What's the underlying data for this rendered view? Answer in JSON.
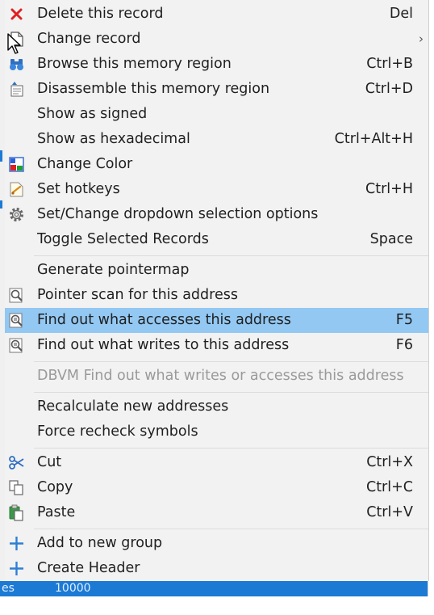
{
  "menu": {
    "items": [
      {
        "id": "delete",
        "label": "Delete this record",
        "shortcut": "Del",
        "icon": "delete-x-icon"
      },
      {
        "id": "change",
        "label": "Change record",
        "shortcut": "",
        "icon": "document-icon",
        "submenu": true
      },
      {
        "id": "browse",
        "label": "Browse this memory region",
        "shortcut": "Ctrl+B",
        "icon": "binoculars-icon"
      },
      {
        "id": "disassemble",
        "label": "Disassemble this memory region",
        "shortcut": "Ctrl+D",
        "icon": "disassemble-icon"
      },
      {
        "id": "signed",
        "label": "Show as signed",
        "shortcut": ""
      },
      {
        "id": "hex",
        "label": "Show as hexadecimal",
        "shortcut": "Ctrl+Alt+H"
      },
      {
        "id": "color",
        "label": "Change Color",
        "shortcut": "",
        "icon": "color-palette-icon"
      },
      {
        "id": "hotkeys",
        "label": "Set hotkeys",
        "shortcut": "Ctrl+H",
        "icon": "hotkey-icon"
      },
      {
        "id": "dropdown",
        "label": "Set/Change dropdown selection options",
        "shortcut": "",
        "icon": "gear-icon"
      },
      {
        "id": "toggle",
        "label": "Toggle Selected Records",
        "shortcut": "Space"
      },
      {
        "id": "pointermap",
        "label": "Generate pointermap",
        "shortcut": ""
      },
      {
        "id": "pointerscan",
        "label": "Pointer scan for this address",
        "shortcut": "",
        "icon": "magnifier-icon"
      },
      {
        "id": "accesses",
        "label": "Find out what accesses this address",
        "shortcut": "F5",
        "icon": "magnifier-list-icon",
        "highlighted": true
      },
      {
        "id": "writes",
        "label": "Find out what writes to this address",
        "shortcut": "F6",
        "icon": "magnifier-list-icon"
      },
      {
        "id": "dbvm",
        "label": "DBVM Find out what writes or accesses this address",
        "shortcut": "",
        "disabled": true
      },
      {
        "id": "recalc",
        "label": "Recalculate new addresses",
        "shortcut": ""
      },
      {
        "id": "recheck",
        "label": "Force recheck symbols",
        "shortcut": ""
      },
      {
        "id": "cut",
        "label": "Cut",
        "shortcut": "Ctrl+X",
        "icon": "scissors-icon"
      },
      {
        "id": "copy",
        "label": "Copy",
        "shortcut": "Ctrl+C",
        "icon": "copy-icon"
      },
      {
        "id": "paste",
        "label": "Paste",
        "shortcut": "Ctrl+V",
        "icon": "paste-icon"
      },
      {
        "id": "addgroup",
        "label": "Add to new group",
        "shortcut": "",
        "icon": "plus-icon"
      },
      {
        "id": "header",
        "label": "Create Header",
        "shortcut": "",
        "icon": "plus-icon"
      }
    ],
    "submenu_arrow": "›"
  },
  "background": {
    "bottom_row_left": "es",
    "bottom_row_value": "10000"
  },
  "colors": {
    "menu_bg": "#f2f2f2",
    "highlight": "#93c8f3",
    "accent_blue": "#1d7ad4",
    "delete_red": "#e02020",
    "disabled_text": "#9a9a9a"
  }
}
